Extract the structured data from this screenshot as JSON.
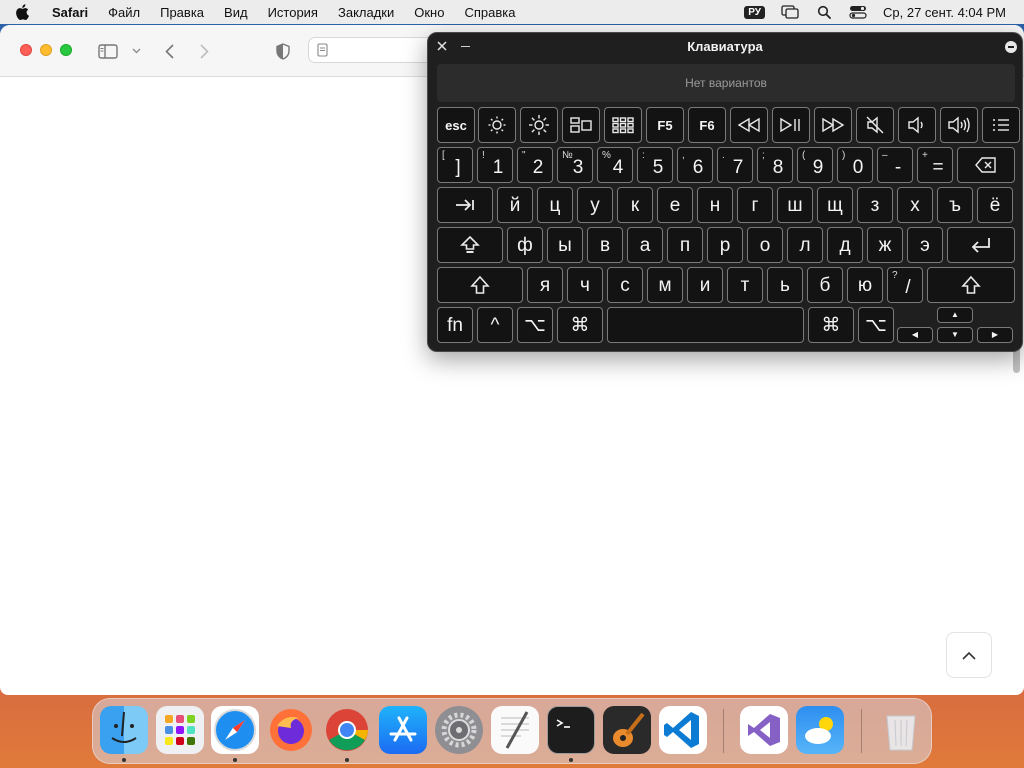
{
  "menubar": {
    "app_name": "Safari",
    "menus": [
      "Файл",
      "Правка",
      "Вид",
      "История",
      "Закладки",
      "Окно",
      "Справка"
    ],
    "input_language": "РУ",
    "clock": "Ср, 27 сент.  4:04 PM"
  },
  "keyboard_viewer": {
    "title": "Клавиатура",
    "suggestion": "Нет вариантов",
    "function_row": [
      {
        "label": "esc",
        "icon": null
      },
      {
        "label": "",
        "icon": "brightness-down-icon"
      },
      {
        "label": "",
        "icon": "brightness-up-icon"
      },
      {
        "label": "",
        "icon": "mission-control-icon"
      },
      {
        "label": "",
        "icon": "launchpad-icon"
      },
      {
        "label": "F5",
        "icon": null
      },
      {
        "label": "F6",
        "icon": null
      },
      {
        "label": "",
        "icon": "rewind-icon"
      },
      {
        "label": "",
        "icon": "play-pause-icon"
      },
      {
        "label": "",
        "icon": "fast-forward-icon"
      },
      {
        "label": "",
        "icon": "mute-icon"
      },
      {
        "label": "",
        "icon": "volume-down-icon"
      },
      {
        "label": "",
        "icon": "volume-up-icon"
      },
      {
        "label": "",
        "icon": "list-icon"
      }
    ],
    "number_row": [
      {
        "shift": "[",
        "main": "]"
      },
      {
        "shift": "!",
        "main": "1"
      },
      {
        "shift": "\"",
        "main": "2"
      },
      {
        "shift": "№",
        "main": "3"
      },
      {
        "shift": "%",
        "main": "4"
      },
      {
        "shift": ":",
        "main": "5"
      },
      {
        "shift": ",",
        "main": "6"
      },
      {
        "shift": ".",
        "main": "7"
      },
      {
        "shift": ";",
        "main": "8"
      },
      {
        "shift": "(",
        "main": "9"
      },
      {
        "shift": ")",
        "main": "0"
      },
      {
        "shift": "–",
        "main": "-"
      },
      {
        "shift": "+",
        "main": "="
      }
    ],
    "row_q": [
      "й",
      "ц",
      "у",
      "к",
      "е",
      "н",
      "г",
      "ш",
      "щ",
      "з",
      "х",
      "ъ",
      "ё"
    ],
    "row_a": [
      "ф",
      "ы",
      "в",
      "а",
      "п",
      "р",
      "о",
      "л",
      "д",
      "ж",
      "э"
    ],
    "row_z": [
      "я",
      "ч",
      "с",
      "м",
      "и",
      "т",
      "ь",
      "б",
      "ю"
    ],
    "row_z_slash": {
      "shift": "?",
      "main": "/"
    },
    "bottom_row": {
      "fn": "fn",
      "control": "^",
      "option": "⌥",
      "command": "⌘"
    },
    "arrows": {
      "up": "▲",
      "left": "◀",
      "down": "▼",
      "right": "▶"
    }
  },
  "dock": {
    "apps": [
      "Finder",
      "Launchpad",
      "Safari",
      "Firefox",
      "Chrome",
      "App Store",
      "System Settings",
      "TextEdit",
      "Terminal",
      "GarageBand",
      "Visual Studio Code",
      "Visual Studio",
      "Weather",
      "Trash"
    ]
  },
  "colors": {
    "accent_red": "#fe5f57",
    "accent_yellow": "#febc2e",
    "accent_green": "#28c840",
    "keyboard_bg": "#1f1f1f"
  }
}
